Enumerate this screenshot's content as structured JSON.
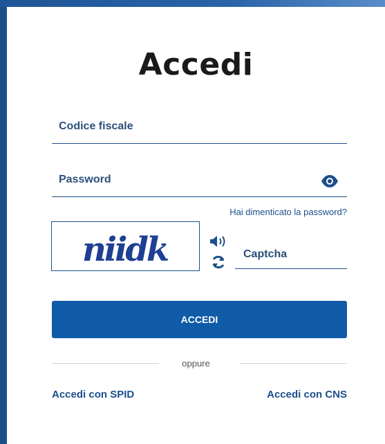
{
  "login": {
    "title": "Accedi",
    "fiscal_code_label": "Codice fiscale",
    "password_label": "Password",
    "forgot_password": "Hai dimenticato la password?",
    "captcha_image_text": "niidk",
    "captcha_label": "Captcha",
    "submit_label": "ACCEDI",
    "or_label": "oppure",
    "spid_link": "Accedi con SPID",
    "cns_link": "Accedi con CNS"
  },
  "icons": [
    "eye-icon",
    "audio-icon",
    "refresh-icon"
  ],
  "colors": {
    "primary": "#0f5ba7",
    "text_dark": "#1a1a1a",
    "link": "#1b4f8a",
    "frame": "#1b4f8a"
  }
}
